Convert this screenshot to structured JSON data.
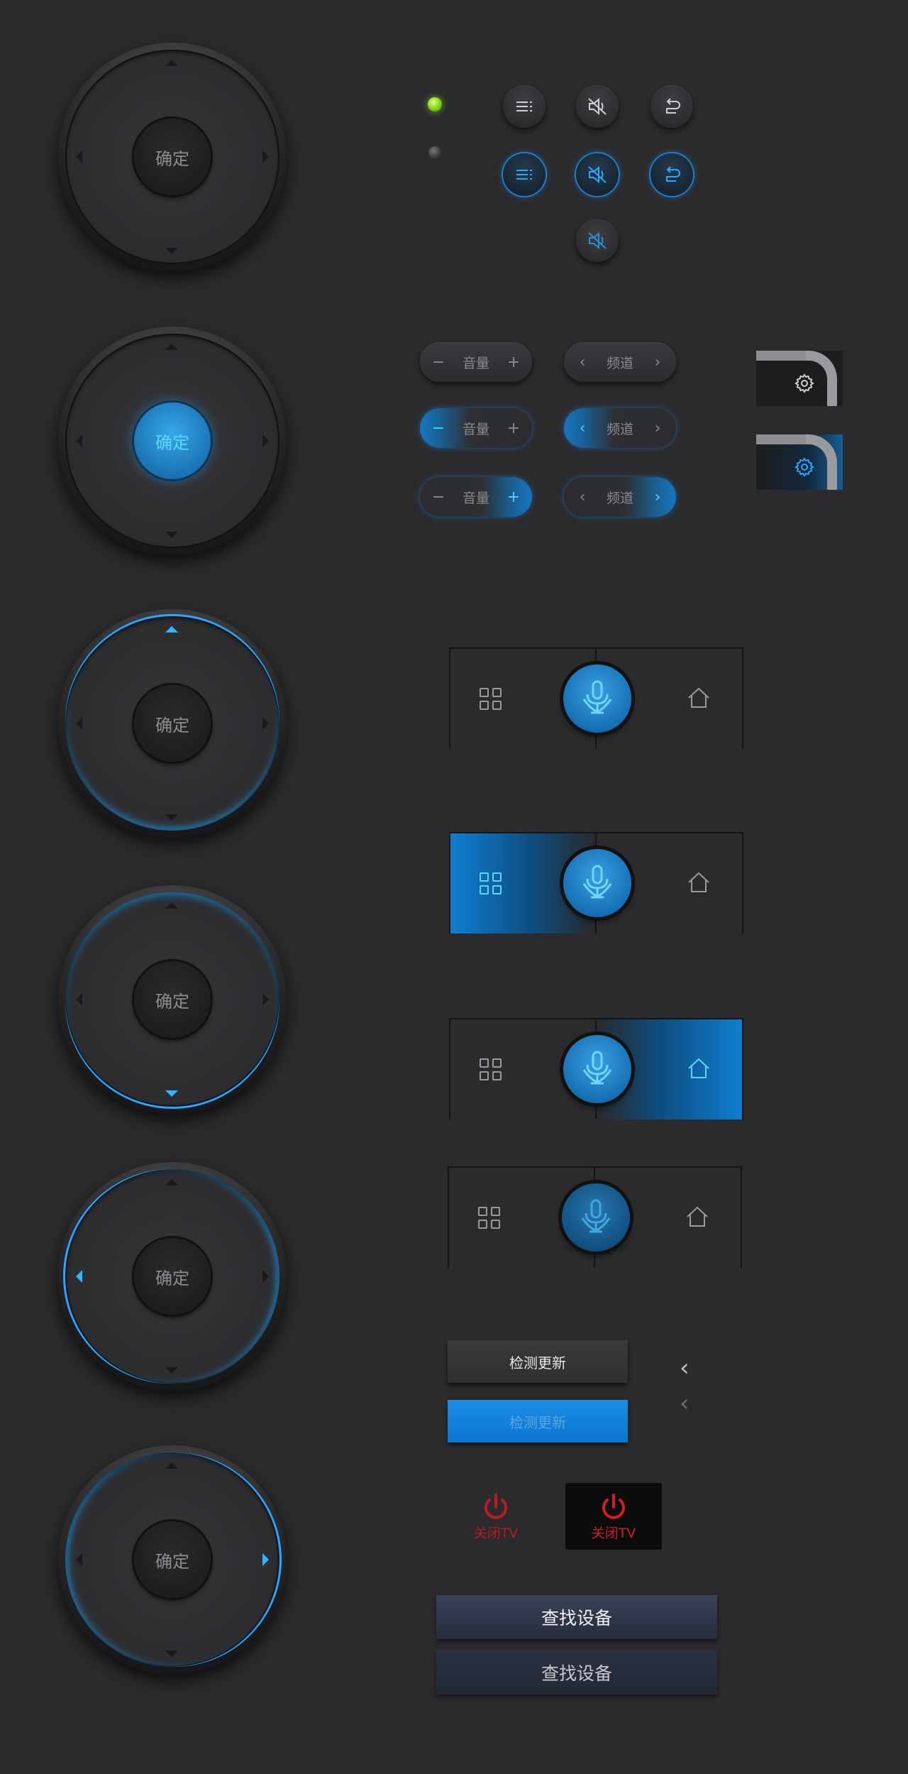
{
  "dpad": {
    "ok_label": "确定"
  },
  "volume": {
    "label": "音量",
    "minus": "−",
    "plus": "+"
  },
  "channel": {
    "label": "频道",
    "prev": "‹",
    "next": "›"
  },
  "update": {
    "label": "检测更新"
  },
  "power": {
    "label": "关闭TV"
  },
  "find": {
    "label": "查找设备"
  },
  "nav": {
    "back": "‹"
  },
  "colors": {
    "accent": "#2aa7ff",
    "led_on": "#8ee020",
    "power_red": "#c01c1c"
  }
}
